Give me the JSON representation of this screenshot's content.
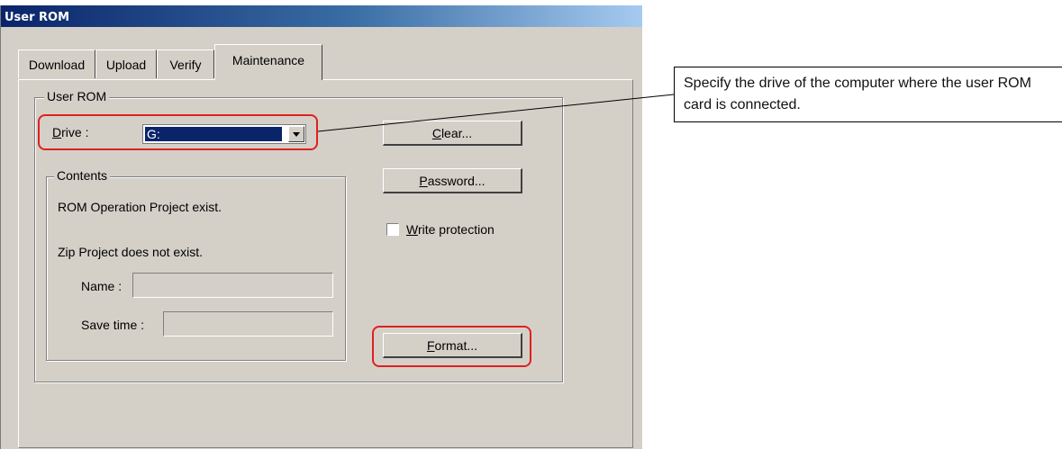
{
  "window": {
    "title": "User ROM"
  },
  "tabs": [
    {
      "label": "Download",
      "active": false
    },
    {
      "label": "Upload",
      "active": false
    },
    {
      "label": "Verify",
      "active": false
    },
    {
      "label": "Maintenance",
      "active": true
    }
  ],
  "user_rom_group": {
    "legend": "User ROM",
    "drive": {
      "label_key": "D",
      "label_rest": "rive :",
      "value": "G:"
    },
    "contents": {
      "legend": "Contents",
      "rom_status": "ROM Operation Project exist.",
      "zip_status": "Zip Project does not exist.",
      "name_label": "Name :",
      "name_value": "",
      "save_time_label": "Save time :",
      "save_time_value": ""
    },
    "clear_button": {
      "key": "C",
      "rest": "lear..."
    },
    "password_button": {
      "key": "P",
      "rest": "assword..."
    },
    "write_protection": {
      "key": "W",
      "rest": "rite protection",
      "checked": false
    },
    "format_button": {
      "key": "F",
      "rest": "ormat..."
    }
  },
  "callout": {
    "text": "Specify the drive of the computer where the user ROM card is connected."
  },
  "colors": {
    "title_gradient_start": "#0a246a",
    "highlight": "#e02020",
    "dialog_bg": "#d4d0c8"
  }
}
